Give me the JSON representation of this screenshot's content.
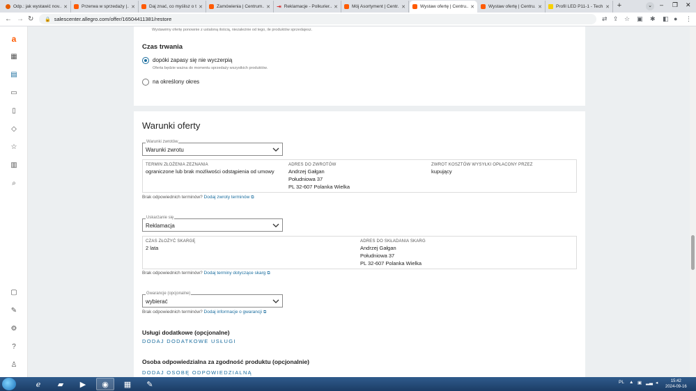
{
  "browser": {
    "tabs": [
      {
        "title": "Odp.: jak wystawić nov...",
        "icon": "gmail-icon",
        "active": false
      },
      {
        "title": "Przerwa w sprzedaży |...",
        "icon": "allegro-icon",
        "active": false
      },
      {
        "title": "Daj znać, co myślisz o t...",
        "icon": "allegro-icon",
        "active": false
      },
      {
        "title": "Zamówienia | Centrum...",
        "icon": "allegro-icon",
        "active": false
      },
      {
        "title": "Reklamacje - Polkurier...",
        "icon": "return-icon",
        "active": false
      },
      {
        "title": "Mój Asortyment | Centr...",
        "icon": "allegro-icon",
        "active": false
      },
      {
        "title": "Wystaw ofertę | Centru...",
        "icon": "allegro-icon",
        "active": true
      },
      {
        "title": "Wystaw ofertę | Centru...",
        "icon": "allegro-icon",
        "active": false
      },
      {
        "title": "Profil LED P11-1 - Tech...",
        "icon": "tme-icon",
        "active": false
      }
    ],
    "url": "salescenter.allegro.com/offer/16504411381/restore"
  },
  "rail": {
    "logo": "a"
  },
  "duration": {
    "top_hint": "Wystawimy ofertę ponownie z ustaloną ilością, niezależnie od tego, ile produktów sprzedajesz.",
    "heading": "Czas trwania",
    "options": [
      {
        "label": "dopóki zapasy się nie wyczerpią",
        "hint": "Oferta będzie ważna do momentu sprzedaży wszystkich produktów.",
        "selected": true
      },
      {
        "label": "na określony okres",
        "hint": "",
        "selected": false
      }
    ]
  },
  "conditions": {
    "title": "Warunki oferty",
    "returns": {
      "legend": "Warunki zwrotów",
      "value": "Warunki zwrotu",
      "col1_head": "TERMIN ZŁOŻENIA ZEZNANIA",
      "col1_val": "ograniczone lub brak możliwości odstąpienia od umowy",
      "col2_head": "ADRES DO ZWROTÓW",
      "col2_lines": [
        "Andrzej Gałgan",
        "Południowa 37",
        "PL 32-607 Polanka Wielka"
      ],
      "col3_head": "ZWROT KOSZTÓW WYSYŁKI OPŁACONY PRZEZ",
      "col3_val": "kupujący",
      "note_text": "Brak odpowiednich terminów?",
      "note_link": "Dodaj zwroty terminów"
    },
    "complaints": {
      "legend": "Uskarżanie się",
      "value": "Reklamacja",
      "col1_head": "CZAS ZŁOŻYĆ SKARGĘ",
      "col1_val": "2 lata",
      "col2_head": "ADRES DO SKŁADANIA SKARG",
      "col2_lines": [
        "Andrzej Gałgan",
        "Południowa 37",
        "PL 32-607 Polanka Wielka"
      ],
      "note_text": "Brak odpowiednich terminów?",
      "note_link": "Dodaj terminy dotyczące skarg"
    },
    "warranty": {
      "legend": "Gwarancje (opcjonalne)",
      "value": "wybierać",
      "note_text": "Brak odpowiednich terminów?",
      "note_link": "Dodaj informacje o gwarancji"
    },
    "services": {
      "heading": "Usługi dodatkowe (opcjonalne)",
      "link": "DODAJ DODATKOWE USŁUGI"
    },
    "responsible": {
      "heading": "Osoba odpowiedzialna za zgodność produktu (opcjonalnie)",
      "link": "DODAJ OSOBĘ ODPOWIEDZIALNĄ"
    }
  },
  "taskbar": {
    "lang": "PL",
    "time": "15:42",
    "date": "2024-09-16"
  }
}
